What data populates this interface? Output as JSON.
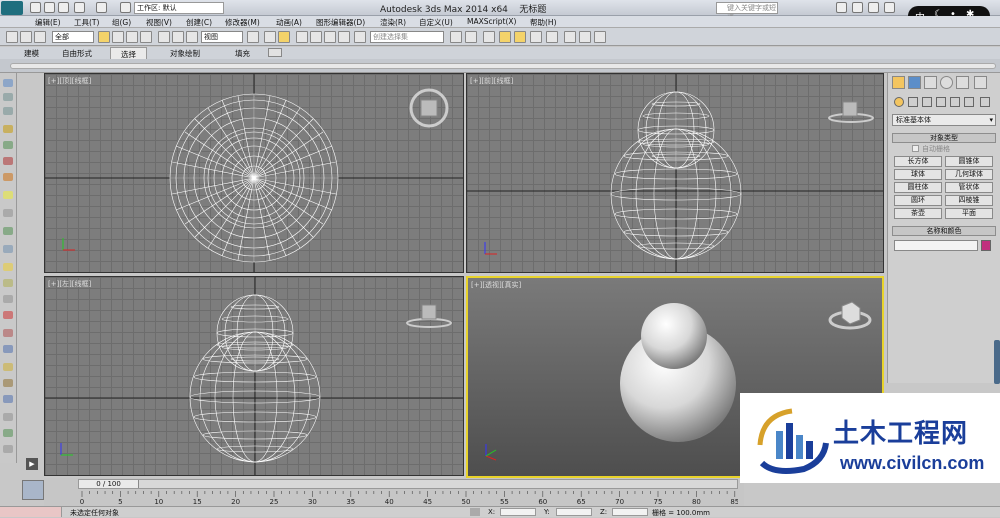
{
  "app": {
    "title": "Autodesk 3ds Max  2014 x64",
    "doc": "无标题",
    "workspace": "工作区: 默认",
    "search_placeholder": "键入关键字或短语"
  },
  "menu": [
    "编辑(E)",
    "工具(T)",
    "组(G)",
    "视图(V)",
    "创建(C)",
    "修改器(M)",
    "动画(A)",
    "图形编辑器(D)",
    "渲染(R)",
    "自定义(U)",
    "MAXScript(X)",
    "帮助(H)"
  ],
  "toolbar": {
    "filter": "全部",
    "refcoord": "视图",
    "selset": "创建选择集"
  },
  "ribbon_tabs": [
    "建模",
    "自由形式",
    "选择",
    "对象绘制",
    "填充"
  ],
  "viewports": {
    "top": "[+][顶][线框]",
    "front": "[+][前][线框]",
    "left": "[+][左][线框]",
    "persp": "[+][透视][真实]"
  },
  "command_panel": {
    "category": "标准基本体",
    "object_type_title": "对象类型",
    "autogrid": "自动栅格",
    "buttons": [
      "长方体",
      "圆锥体",
      "球体",
      "几何球体",
      "圆柱体",
      "管状体",
      "圆环",
      "四棱锥",
      "茶壶",
      "平面"
    ],
    "name_color_title": "名称和颜色"
  },
  "timeline": {
    "frame": "0 / 100",
    "ticks": [
      "0",
      "5",
      "10",
      "15",
      "20",
      "25",
      "30",
      "35",
      "40",
      "45",
      "50",
      "55",
      "60",
      "65",
      "70",
      "75",
      "80",
      "85"
    ]
  },
  "status": {
    "message": "未选定任何对象",
    "grid": "栅格 = 100.0mm",
    "x": "X:",
    "y": "Y:",
    "z": "Z:"
  },
  "watermark": {
    "brand": "土木工程网",
    "url": "www.civilcn.com"
  },
  "ime": {
    "lang": "中"
  },
  "colors": {
    "active_viewport": "#e8d32a",
    "viewport_bg": "#7d7d7d",
    "watermark_blue": "#1a3e9a",
    "name_swatch": "#c0307e"
  }
}
